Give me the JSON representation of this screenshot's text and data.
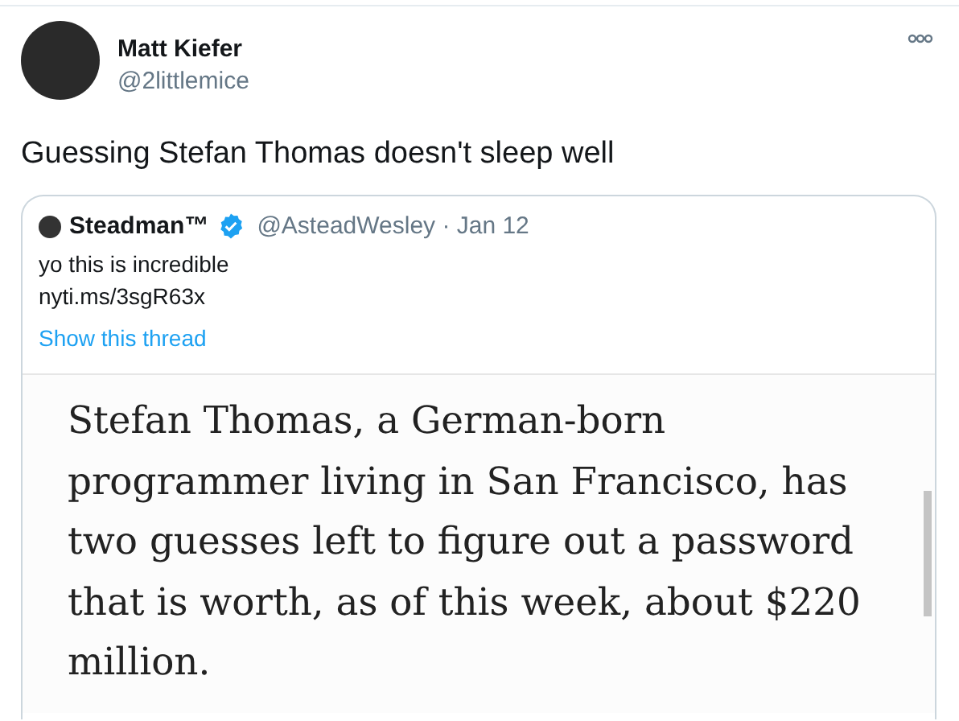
{
  "tweet": {
    "author": {
      "name": "Matt Kiefer",
      "handle": "@2littlemice"
    },
    "text": "Guessing Stefan Thomas doesn't sleep well",
    "quoted_tweet": {
      "author": {
        "name": "Steadman™",
        "verified": true,
        "handle": "@AsteadWesley",
        "date": "· Jan 12"
      },
      "text_lines": [
        "yo this is incredible",
        "nyti.ms/3sgR63x"
      ],
      "show_thread": "Show this thread",
      "article_image": {
        "lines": [
          "Stefan Thomas, a German-born",
          "programmer living in San Francisco, has",
          "two guesses left to figure out a password",
          "that is worth, as of this week, about $220",
          "million."
        ]
      }
    }
  }
}
